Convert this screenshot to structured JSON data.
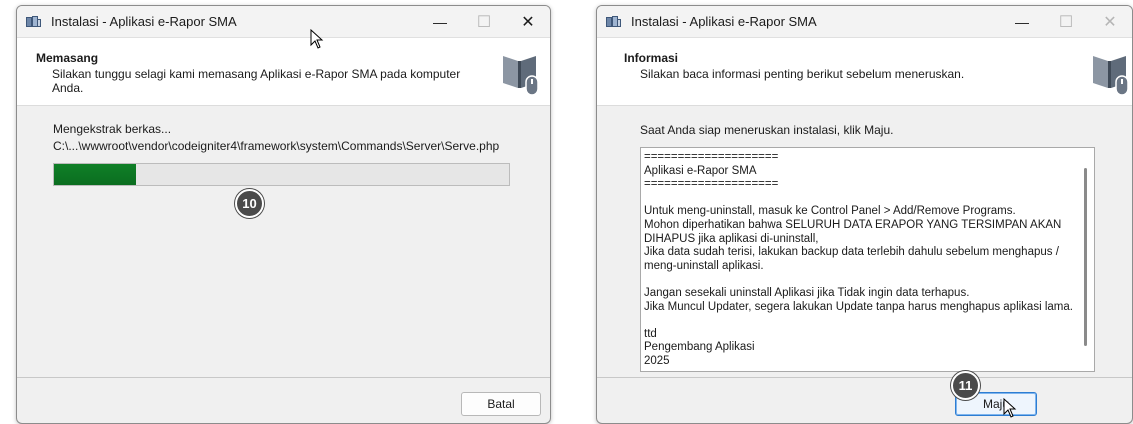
{
  "left_window": {
    "title": "Instalasi - Aplikasi e-Rapor SMA",
    "caption": {
      "minimize": "—",
      "maximize": "☐",
      "close": "✕"
    },
    "header_title": "Memasang",
    "header_desc": "Silakan tunggu selagi kami memasang Aplikasi e-Rapor SMA pada komputer Anda.",
    "status_label": "Mengekstrak berkas...",
    "status_path": "C:\\...\\wwwroot\\vendor\\codeigniter4\\framework\\system\\Commands\\Server\\Serve.php",
    "progress_fraction": 0.18,
    "badge": "10",
    "cancel_label": "Batal"
  },
  "right_window": {
    "title": "Instalasi - Aplikasi e-Rapor SMA",
    "caption": {
      "minimize": "—",
      "maximize": "☐",
      "close": "✕"
    },
    "header_title": "Informasi",
    "header_desc": "Silakan baca informasi penting berikut sebelum meneruskan.",
    "intro": "Saat Anda siap meneruskan instalasi, klik Maju.",
    "memo": "====================\nAplikasi e-Rapor SMA\n====================\n\nUntuk meng-uninstall, masuk ke Control Panel > Add/Remove Programs.\nMohon diperhatikan bahwa SELURUH DATA ERAPOR YANG TERSIMPAN AKAN DIHAPUS jika aplikasi di-uninstall,\nJika data sudah terisi, lakukan backup data terlebih dahulu sebelum menghapus / meng-uninstall aplikasi.\n\nJangan sesekali uninstall Aplikasi jika Tidak ingin data terhapus.\nJika Muncul Updater, segera lakukan Update tanpa harus menghapus aplikasi lama.\n\nttd\nPengembang Aplikasi\n2025",
    "badge": "11",
    "next_label": "Maju"
  },
  "colors": {
    "progress_fill": "#0b6e20",
    "badge_bg": "#4a4a4a",
    "default_button_border": "#2d7dd2"
  },
  "icons": [
    "app-installer-icon",
    "book-mouse-graphic",
    "mouse-cursor-icon"
  ]
}
